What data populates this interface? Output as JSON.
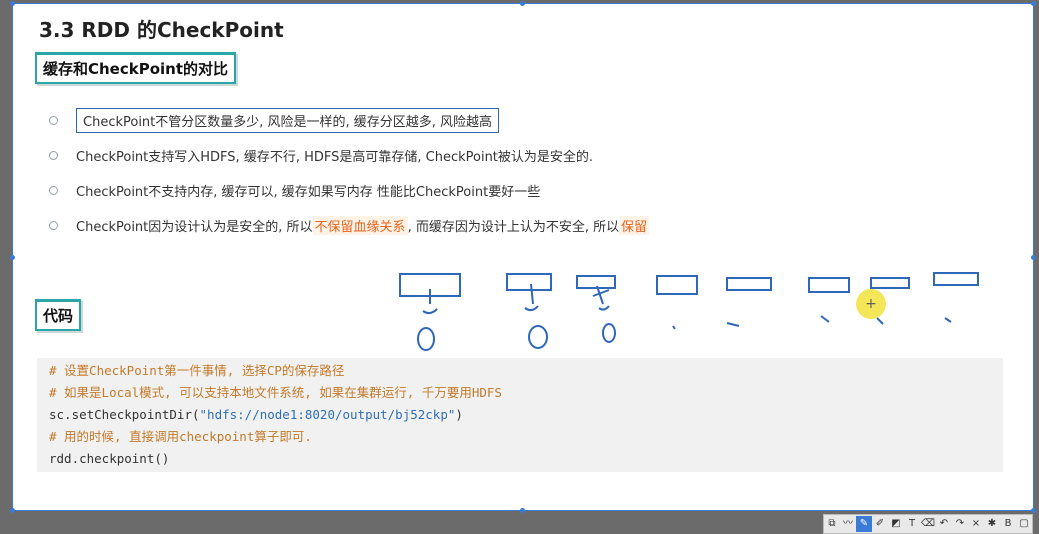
{
  "slide": {
    "title": "3.3 RDD 的CheckPoint",
    "section1": "缓存和CheckPoint的对比",
    "bullets": [
      "CheckPoint不管分区数量多少, 风险是一样的, 缓存分区越多, 风险越高",
      "CheckPoint支持写入HDFS, 缓存不行, HDFS是高可靠存储, CheckPoint被认为是安全的.",
      "CheckPoint不支持内存, 缓存可以, 缓存如果写内存 性能比CheckPoint要好一些"
    ],
    "bullet4": {
      "part1": "CheckPoint因为设计认为是安全的, 所以 ",
      "hl1": "不保留血缘关系",
      "part2": " , 而缓存因为设计上认为不安全, 所以 ",
      "hl2": "保留"
    },
    "section2": "代码",
    "code": {
      "line1": "# 设置CheckPoint第一件事情, 选择CP的保存路径",
      "line2": "# 如果是Local模式, 可以支持本地文件系统, 如果在集群运行, 千万要用HDFS",
      "line3_fn": "sc.setCheckpointDir(",
      "line3_str": "\"hdfs://node1:8020/output/bj52ckp\"",
      "line3_end": ")",
      "line4": "# 用的时候, 直接调用checkpoint算子即可.",
      "line5": "rdd.checkpoint()"
    }
  },
  "cursor_glyph": "+",
  "toolbar": {
    "icons": [
      "screen-icon",
      "curve-icon",
      "pen-icon",
      "marker-icon",
      "shape-icon",
      "text-icon",
      "eraser-icon",
      "undo-icon",
      "redo-icon",
      "close-icon",
      "pin-icon",
      "save-icon",
      "window-icon"
    ],
    "glyphs": [
      "⧉",
      "〰",
      "✎",
      "✐",
      "◩",
      "T",
      "⌫",
      "↶",
      "↷",
      "×",
      "✱",
      "B",
      "▢"
    ]
  },
  "colors": {
    "accent": "#2aa6a6",
    "highlight": "#e5651e",
    "border": "#3a7bd5"
  }
}
